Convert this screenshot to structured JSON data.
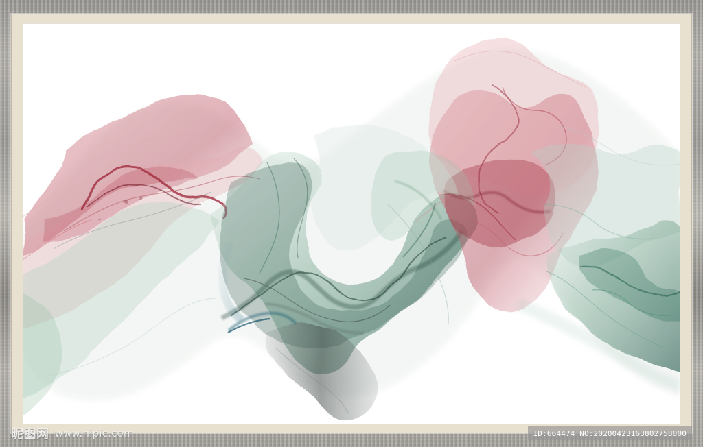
{
  "watermarks": {
    "left_logo": "昵图网",
    "left_site": "www.nipic.com",
    "right_text": "ID:664474 NO:20200423163802758000"
  },
  "colors": {
    "frame": "#a9a69f",
    "mat": "#e8e1d0",
    "paper": "#ffffff",
    "rose": "#c56a75",
    "deep_rose": "#9f2637",
    "jade": "#6b9f86",
    "deep_jade": "#234f3f",
    "teal": "#2f6f84",
    "grey_ink": "#5d6460"
  },
  "artwork": {
    "name": "abstract alcohol ink painting",
    "palette": [
      "rose",
      "jade",
      "teal",
      "grey"
    ]
  }
}
